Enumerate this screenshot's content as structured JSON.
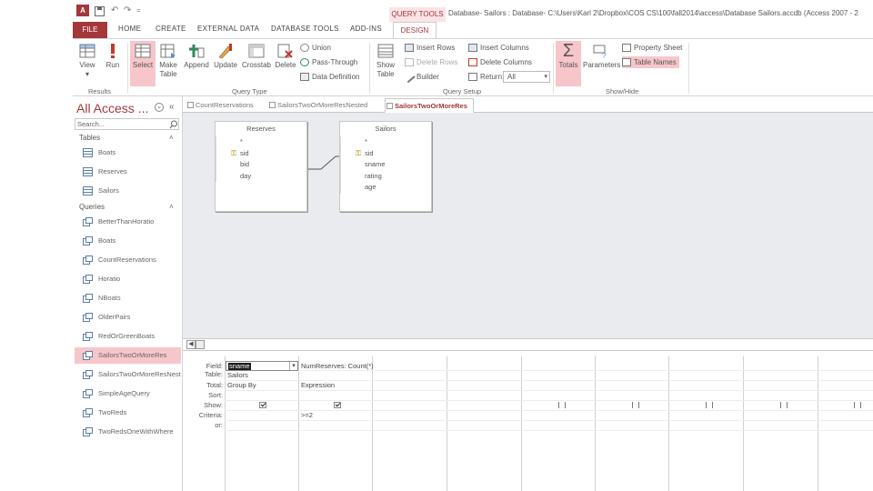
{
  "window": {
    "title": "Database- Sailors : Database- C:\\Users\\Karl 2\\Dropbox\\COS CS\\100\\fall2014\\access\\Database Sailors.accdb (Access 2007 - 2",
    "context_tab": "QUERY TOOLS",
    "qat_symbols": [
      "↶",
      "↷",
      "="
    ]
  },
  "ribbon_tabs": [
    "FILE",
    "HOME",
    "CREATE",
    "EXTERNAL DATA",
    "DATABASE TOOLS",
    "ADD-INS",
    "DESIGN"
  ],
  "ribbon": {
    "results": {
      "group": "Results",
      "view": "View",
      "run": "Run"
    },
    "query_type": {
      "group": "Query Type",
      "select": "Select",
      "make_table": [
        "Make",
        "Table"
      ],
      "append": "Append",
      "update": "Update",
      "crosstab": "Crosstab",
      "delete": "Delete",
      "union": "Union",
      "pass_through": "Pass-Through",
      "data_definition": "Data Definition"
    },
    "query_setup": {
      "group": "Query Setup",
      "show_table": [
        "Show",
        "Table"
      ],
      "insert_rows": "Insert Rows",
      "delete_rows": "Delete Rows",
      "builder": "Builder",
      "insert_columns": "Insert Columns",
      "delete_columns": "Delete Columns",
      "return_label": "Return:",
      "return_value": "All"
    },
    "show_hide": {
      "group": "Show/Hide",
      "totals": "Totals",
      "parameters": "Parameters",
      "property_sheet": "Property Sheet",
      "table_names": "Table Names"
    }
  },
  "nav": {
    "title": "All Access ...",
    "search_placeholder": "Search...",
    "tables_header": "Tables",
    "tables": [
      "Boats",
      "Reserves",
      "Sailors"
    ],
    "queries_header": "Queries",
    "queries": [
      "BetterThanHoratio",
      "Boats",
      "CountReservations",
      "Horatio",
      "NBoats",
      "OlderPairs",
      "RedOrGreenBoats",
      "SailorsTwoOrMoreRes",
      "SailorsTwoOrMoreResNested",
      "SimpleAgeQuery",
      "TwoReds",
      "TwoRedsOneWithWhere"
    ],
    "selected_query": "SailorsTwoOrMoreRes"
  },
  "doc_tabs": [
    "CountReservations",
    "SailorsTwoOrMoreResNested",
    "SailorsTwoOrMoreRes"
  ],
  "active_doc_tab": "SailorsTwoOrMoreRes",
  "tables_design": [
    {
      "name": "Reserves",
      "fields": [
        "*",
        "sid",
        "bid",
        "day"
      ],
      "key": "sid"
    },
    {
      "name": "Sailors",
      "fields": [
        "*",
        "sid",
        "sname",
        "rating",
        "age"
      ],
      "key": "sid"
    }
  ],
  "grid": {
    "row_labels": [
      "Field:",
      "Table:",
      "Total:",
      "Sort:",
      "Show:",
      "Criteria:",
      "or:"
    ],
    "columns": [
      {
        "field": "sname",
        "table": "Sailors",
        "total": "Group By",
        "sort": "",
        "show": true,
        "criteria": ""
      },
      {
        "field": "NumReserves: Count(*)",
        "table": "",
        "total": "Expression",
        "sort": "",
        "show": true,
        "criteria": ">=2"
      }
    ]
  }
}
